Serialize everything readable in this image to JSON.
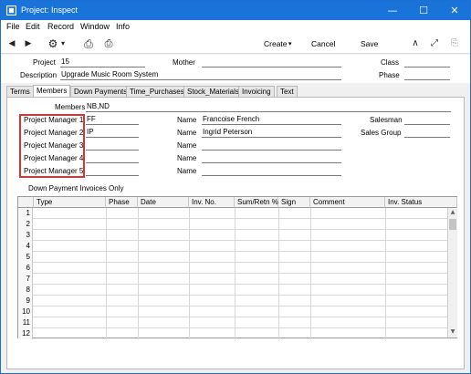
{
  "window": {
    "title": "Project: Inspect",
    "minimize": "—",
    "maximize": "☐",
    "close": "✕"
  },
  "menu": [
    "File",
    "Edit",
    "Record",
    "Window",
    "Info"
  ],
  "toolbar": {
    "create_label": "Create",
    "create_arrow": "▾",
    "cancel_label": "Cancel",
    "save_label": "Save",
    "icons": {
      "prev": "◀",
      "next": "▶",
      "settings": "⚙",
      "settings_arrow": "▾",
      "print": "⎙",
      "print_preview": "⎙",
      "stats": "∧",
      "expand": "⤢",
      "attach": "⎘"
    }
  },
  "header": {
    "project_label": "Project",
    "project_value": "15",
    "mother_label": "Mother",
    "mother_value": "",
    "class_label": "Class",
    "class_value": "",
    "description_label": "Description",
    "description_value": "Upgrade Music Room System",
    "phase_label": "Phase",
    "phase_value": ""
  },
  "tabs": [
    {
      "label": "Terms",
      "active": false
    },
    {
      "label": "Members",
      "active": true
    },
    {
      "label": "Down Payments",
      "active": false
    },
    {
      "label": "Time_Purchases",
      "active": false
    },
    {
      "label": "Stock_Materials",
      "active": false
    },
    {
      "label": "Invoicing",
      "active": false
    },
    {
      "label": "Text",
      "active": false
    }
  ],
  "members": {
    "members_label": "Members",
    "members_value": "NB,ND",
    "managers": [
      {
        "label": "Project Manager 1",
        "code": "FF",
        "name_label": "Name",
        "name": "Francoise French"
      },
      {
        "label": "Project Manager 2",
        "code": "IP",
        "name_label": "Name",
        "name": "Ingrid Peterson"
      },
      {
        "label": "Project Manager 3",
        "code": "",
        "name_label": "Name",
        "name": ""
      },
      {
        "label": "Project Manager 4",
        "code": "",
        "name_label": "Name",
        "name": ""
      },
      {
        "label": "Project Manager 5",
        "code": "",
        "name_label": "Name",
        "name": ""
      }
    ],
    "salesman_label": "Salesman",
    "salesman_value": "",
    "sales_group_label": "Sales Group",
    "sales_group_value": "",
    "highlight_color": "#e03030"
  },
  "down_payments": {
    "label": "Down Payment Invoices Only",
    "columns": [
      "Type",
      "Phase",
      "Date",
      "Inv. No.",
      "Sum/Retn %",
      "Sign",
      "Comment",
      "Inv. Status"
    ],
    "rows": [
      "1",
      "2",
      "3",
      "4",
      "5",
      "6",
      "7",
      "8",
      "9",
      "10",
      "11",
      "12"
    ],
    "scroll_up": "▲",
    "scroll_down": "▼"
  },
  "colors": {
    "titlebar": "#1a73d8",
    "window_bg": "#f0f0f0"
  }
}
